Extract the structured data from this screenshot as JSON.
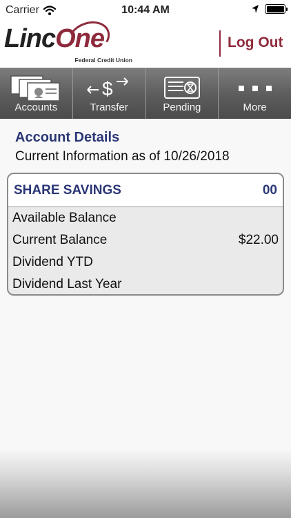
{
  "status_bar": {
    "carrier": "Carrier",
    "time": "10:44 AM"
  },
  "header": {
    "logo_linc": "Linc",
    "logo_one": "One",
    "logo_sub": "Federal Credit Union",
    "logout_label": "Log Out"
  },
  "nav": {
    "items": [
      {
        "label": "Accounts",
        "icon": "accounts-icon"
      },
      {
        "label": "Transfer",
        "icon": "transfer-icon"
      },
      {
        "label": "Pending",
        "icon": "pending-icon"
      },
      {
        "label": "More",
        "icon": "more-icon"
      }
    ]
  },
  "page": {
    "title": "Account Details",
    "subtitle": "Current Information as of 10/26/2018"
  },
  "account": {
    "name": "SHARE SAVINGS",
    "suffix": "00",
    "rows": [
      {
        "label": "Available Balance",
        "value": ""
      },
      {
        "label": "Current Balance",
        "value": "$22.00"
      },
      {
        "label": "Dividend YTD",
        "value": ""
      },
      {
        "label": "Dividend Last Year",
        "value": ""
      }
    ]
  },
  "colors": {
    "brand": "#8e2a3c",
    "title": "#2a3675",
    "nav_bg": "#5c5c5c"
  }
}
